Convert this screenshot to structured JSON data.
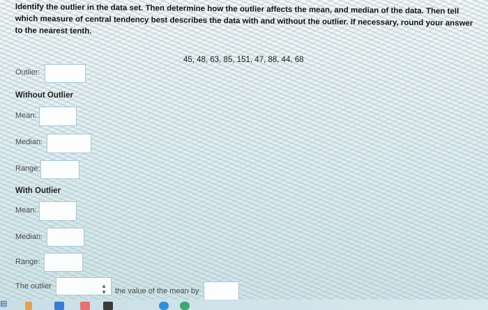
{
  "question": {
    "instructions": "Identify the outlier in the data set. Then determine how the outlier affects the mean, and median of the data. Then tell which measure of central tendency best describes the data with and without the outlier. If necessary, round your answer to the nearest tenth.",
    "data_set": "45, 48, 63, 85, 151, 47, 88, 44, 68"
  },
  "outlier": {
    "label": "Outlier:",
    "value": ""
  },
  "without_outlier": {
    "heading": "Without Outlier",
    "mean_label": "Mean:",
    "mean_value": "",
    "median_label": "Median:",
    "median_value": "",
    "range_label": "Range:",
    "range_value": ""
  },
  "with_outlier": {
    "heading": "With Outlier",
    "mean_label": "Mean:",
    "mean_value": "",
    "median_label": "Median:",
    "median_value": "",
    "range_label": "Range:",
    "range_value": ""
  },
  "sentence": {
    "prefix": "The outlier",
    "select_value": "",
    "select_icon": "up-down-arrow-icon",
    "middle": "the value of the mean by",
    "answer_value": ""
  },
  "taskbar": {
    "icons": [
      "app-icon-1",
      "app-icon-2",
      "app-icon-3",
      "app-icon-4",
      "app-icon-5",
      "app-icon-6"
    ]
  },
  "colors": {
    "box_border": "#a8c9dc",
    "label_text": "#4a4a4a",
    "heading_text": "#222222"
  }
}
